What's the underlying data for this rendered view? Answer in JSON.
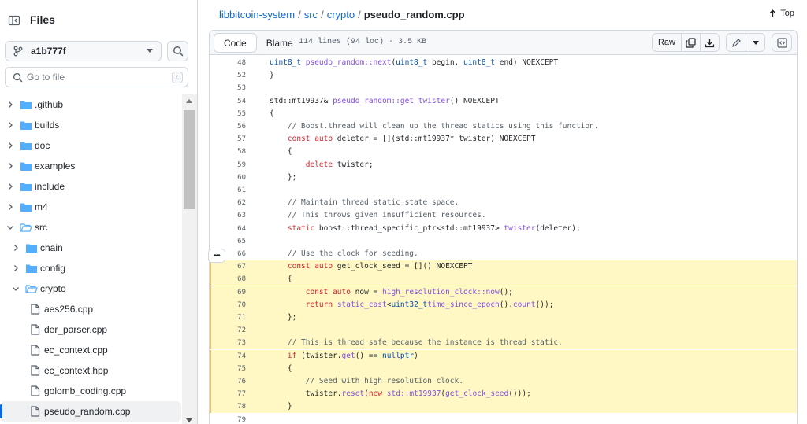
{
  "sidebar": {
    "title": "Files",
    "branch": "a1b777f",
    "goto_placeholder": "Go to file",
    "goto_shortcut": "t",
    "tree": [
      {
        "label": ".github",
        "type": "folder",
        "level": 0,
        "expanded": false
      },
      {
        "label": "builds",
        "type": "folder",
        "level": 0,
        "expanded": false
      },
      {
        "label": "doc",
        "type": "folder",
        "level": 0,
        "expanded": false
      },
      {
        "label": "examples",
        "type": "folder",
        "level": 0,
        "expanded": false
      },
      {
        "label": "include",
        "type": "folder",
        "level": 0,
        "expanded": false
      },
      {
        "label": "m4",
        "type": "folder",
        "level": 0,
        "expanded": false
      },
      {
        "label": "src",
        "type": "folder",
        "level": 0,
        "expanded": true
      },
      {
        "label": "chain",
        "type": "folder",
        "level": 1,
        "expanded": false
      },
      {
        "label": "config",
        "type": "folder",
        "level": 1,
        "expanded": false
      },
      {
        "label": "crypto",
        "type": "folder",
        "level": 1,
        "expanded": true
      },
      {
        "label": "aes256.cpp",
        "type": "file",
        "level": 2
      },
      {
        "label": "der_parser.cpp",
        "type": "file",
        "level": 2
      },
      {
        "label": "ec_context.cpp",
        "type": "file",
        "level": 2
      },
      {
        "label": "ec_context.hpp",
        "type": "file",
        "level": 2
      },
      {
        "label": "golomb_coding.cpp",
        "type": "file",
        "level": 2
      },
      {
        "label": "pseudo_random.cpp",
        "type": "file",
        "level": 2,
        "selected": true
      }
    ]
  },
  "breadcrumb": {
    "repo": "libbitcoin-system",
    "dir1": "src",
    "dir2": "crypto",
    "file": "pseudo_random.cpp",
    "sep": "/"
  },
  "top_label": "Top",
  "toolbar": {
    "code_tab": "Code",
    "blame_tab": "Blame",
    "meta": "114 lines (94 loc) · 3.5 KB",
    "raw_label": "Raw"
  },
  "icons": {
    "sidebar_toggle": "sidebar-collapse-icon",
    "branch": "git-branch-icon",
    "search": "search-icon",
    "folder": "folder-icon",
    "file": "file-icon",
    "copy": "copy-icon",
    "download": "download-icon",
    "edit": "pencil-icon",
    "symbols": "code-square-icon"
  },
  "colors": {
    "link": "#0969da",
    "folder": "#54aeff",
    "highlight": "#fff8c5",
    "keyword": "#cf222e",
    "function": "#8250df",
    "type": "#0550ae",
    "comment": "#57606a"
  },
  "code": [
    {
      "n": "48",
      "hl": false,
      "tokens": [
        [
          "ty",
          "uint8_t "
        ],
        [
          "fn",
          "pseudo_random::next"
        ],
        [
          "",
          "("
        ],
        [
          "ty",
          "uint8_t"
        ],
        [
          "",
          " begin, "
        ],
        [
          "ty",
          "uint8_t"
        ],
        [
          "",
          " end) NOEXCEPT"
        ]
      ]
    },
    {
      "n": "52",
      "hl": false,
      "tokens": [
        [
          "",
          "}"
        ]
      ]
    },
    {
      "n": "53",
      "hl": false,
      "tokens": []
    },
    {
      "n": "54",
      "hl": false,
      "tokens": [
        [
          "",
          "std::mt19937& "
        ],
        [
          "fn",
          "pseudo_random::get_twister"
        ],
        [
          "",
          "() NOEXCEPT"
        ]
      ]
    },
    {
      "n": "55",
      "hl": false,
      "tokens": [
        [
          "",
          "{"
        ]
      ]
    },
    {
      "n": "56",
      "hl": false,
      "tokens": [
        [
          "cm",
          "    // Boost.thread will clean up the thread statics using this function."
        ]
      ]
    },
    {
      "n": "57",
      "hl": false,
      "tokens": [
        [
          "kw",
          "    const auto"
        ],
        [
          "",
          " deleter = [](std::mt19937* twister) NOEXCEPT"
        ]
      ]
    },
    {
      "n": "58",
      "hl": false,
      "tokens": [
        [
          "",
          "    {"
        ]
      ]
    },
    {
      "n": "59",
      "hl": false,
      "tokens": [
        [
          "kw",
          "        delete"
        ],
        [
          "",
          " twister;"
        ]
      ]
    },
    {
      "n": "60",
      "hl": false,
      "tokens": [
        [
          "",
          "    };"
        ]
      ]
    },
    {
      "n": "61",
      "hl": false,
      "tokens": []
    },
    {
      "n": "62",
      "hl": false,
      "tokens": [
        [
          "cm",
          "    // Maintain thread static state space."
        ]
      ]
    },
    {
      "n": "63",
      "hl": false,
      "tokens": [
        [
          "cm",
          "    // This throws given insufficient resources."
        ]
      ]
    },
    {
      "n": "64",
      "hl": false,
      "tokens": [
        [
          "kw",
          "    static"
        ],
        [
          "",
          " boost::thread_specific_ptr<std::mt19937> "
        ],
        [
          "fn",
          "twister"
        ],
        [
          "",
          "(deleter);"
        ]
      ]
    },
    {
      "n": "65",
      "hl": false,
      "tokens": []
    },
    {
      "n": "66",
      "hl": false,
      "tokens": [
        [
          "cm",
          "    // Use the clock for seeding."
        ]
      ]
    },
    {
      "n": "67",
      "hl": true,
      "tokens": [
        [
          "kw",
          "    const auto"
        ],
        [
          "",
          " get_clock_seed = []() NOEXCEPT"
        ]
      ]
    },
    {
      "n": "68",
      "hl": true,
      "tokens": [
        [
          "",
          "    {"
        ]
      ]
    },
    {
      "n": "69",
      "hl": true,
      "tokens": [
        [
          "kw",
          "        const auto"
        ],
        [
          "",
          " now = "
        ],
        [
          "fn",
          "high_resolution_clock::now"
        ],
        [
          "",
          "();"
        ]
      ]
    },
    {
      "n": "70",
      "hl": true,
      "tokens": [
        [
          "kw",
          "        return"
        ],
        [
          "",
          " "
        ],
        [
          "fn",
          "static_cast"
        ],
        [
          "",
          "<"
        ],
        [
          "ty",
          "uint32_t"
        ],
        [
          ">(now."
        ],
        [
          "fn",
          "time_since_epoch"
        ],
        [
          "",
          "()."
        ],
        [
          "fn",
          "count"
        ],
        [
          "",
          "());"
        ]
      ]
    },
    {
      "n": "71",
      "hl": true,
      "tokens": [
        [
          "",
          "    };"
        ]
      ]
    },
    {
      "n": "72",
      "hl": true,
      "tokens": []
    },
    {
      "n": "73",
      "hl": true,
      "tokens": [
        [
          "cm",
          "    // This is thread safe because the instance is thread static."
        ]
      ]
    },
    {
      "n": "74",
      "hl": true,
      "tokens": [
        [
          "kw",
          "    if"
        ],
        [
          "",
          " (twister."
        ],
        [
          "fn",
          "get"
        ],
        [
          "",
          "() == "
        ],
        [
          "ty",
          "nullptr"
        ],
        [
          "",
          ")"
        ]
      ]
    },
    {
      "n": "75",
      "hl": true,
      "tokens": [
        [
          "",
          "    {"
        ]
      ]
    },
    {
      "n": "76",
      "hl": true,
      "tokens": [
        [
          "cm",
          "        // Seed with high resolution clock."
        ]
      ]
    },
    {
      "n": "77",
      "hl": true,
      "tokens": [
        [
          "",
          " "
        ],
        [
          "",
          "       twister."
        ],
        [
          "fn",
          "reset"
        ],
        [
          "",
          "("
        ],
        [
          "kw",
          "new"
        ],
        [
          "",
          " "
        ],
        [
          "fn",
          "std::mt19937"
        ],
        [
          "",
          "("
        ],
        [
          "fn",
          "get_clock_seed"
        ],
        [
          "",
          "()));"
        ]
      ]
    },
    {
      "n": "78",
      "hl": true,
      "tokens": [
        [
          "",
          "    }"
        ]
      ]
    },
    {
      "n": "79",
      "hl": false,
      "tokens": []
    }
  ]
}
